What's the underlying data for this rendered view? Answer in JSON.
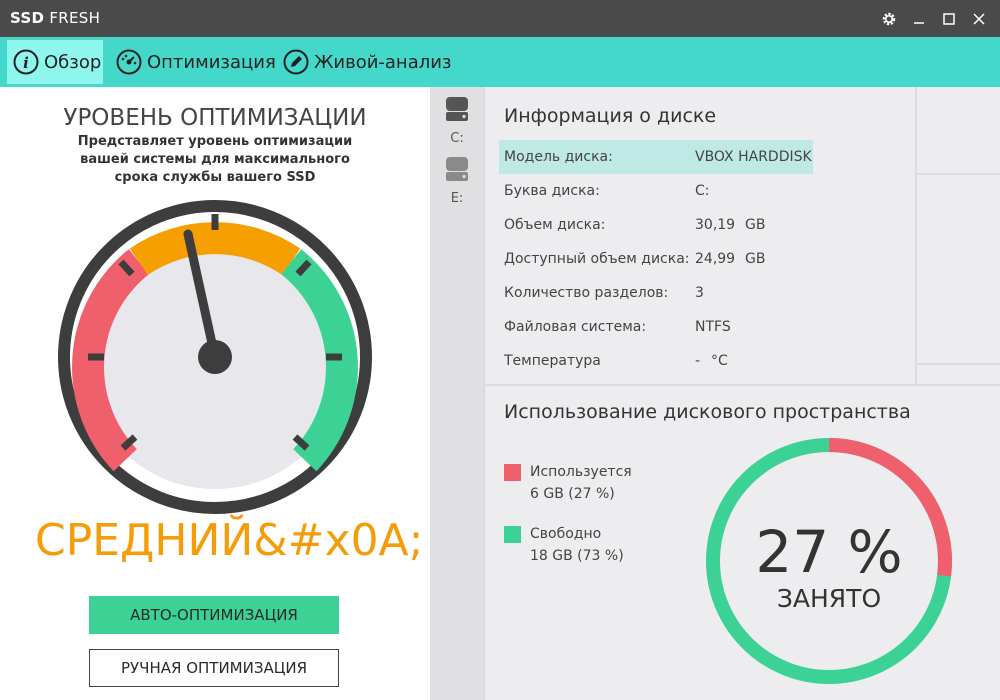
{
  "app": {
    "title_bold": "SSD",
    "title_rest": "FRESH"
  },
  "window_controls": {
    "settings": "settings",
    "minimize": "minimize",
    "maximize": "maximize",
    "close": "close"
  },
  "tabs": [
    {
      "label": "Обзор",
      "icon": "info-icon",
      "active": true
    },
    {
      "label": "Оптимизация",
      "icon": "speedometer-icon",
      "active": false
    },
    {
      "label": "Живой-анализ",
      "icon": "pencil-icon",
      "active": false
    }
  ],
  "optimization": {
    "title": "УРОВЕНЬ ОПТИМИЗАЦИИ",
    "description": "Представляет уровень оптимизации вашей системы для максимального срока службы вашего SSD",
    "level_text": "СРЕДНИЙ&#x0A;",
    "auto_button": "АВТО-ОПТИМИЗАЦИЯ",
    "manual_button": "РУЧНАЯ ОПТИМИЗАЦИЯ"
  },
  "drives": [
    {
      "letter": "C:",
      "selected": true
    },
    {
      "letter": "E:",
      "selected": false
    }
  ],
  "disk_info": {
    "title": "Информация о диске",
    "rows": [
      {
        "label": "Модель диска:",
        "value": "VBOX HARDDISK",
        "unit": ""
      },
      {
        "label": "Буква диска:",
        "value": "C:",
        "unit": ""
      },
      {
        "label": "Объем диска:",
        "value": "30,19",
        "unit": "GB"
      },
      {
        "label": "Доступный объем диска:",
        "value": "24,99",
        "unit": "GB"
      },
      {
        "label": "Количество разделов:",
        "value": "3",
        "unit": ""
      },
      {
        "label": "Файловая система:",
        "value": "NTFS",
        "unit": ""
      },
      {
        "label": "Температура",
        "value": "-",
        "unit": "°C"
      }
    ]
  },
  "usage": {
    "title": "Использование дискового пространства",
    "used_label": "Используется",
    "used_value": "6 GB (27 %)",
    "free_label": "Свободно",
    "free_value": "18 GB (73 %)",
    "percent_text": "27 %",
    "percent_label": "ЗАНЯТО",
    "used_fraction": 0.27
  },
  "colors": {
    "accent": "#43d8c9",
    "used": "#f0606c",
    "free": "#3cd295",
    "gauge_mid": "#f5a000"
  }
}
